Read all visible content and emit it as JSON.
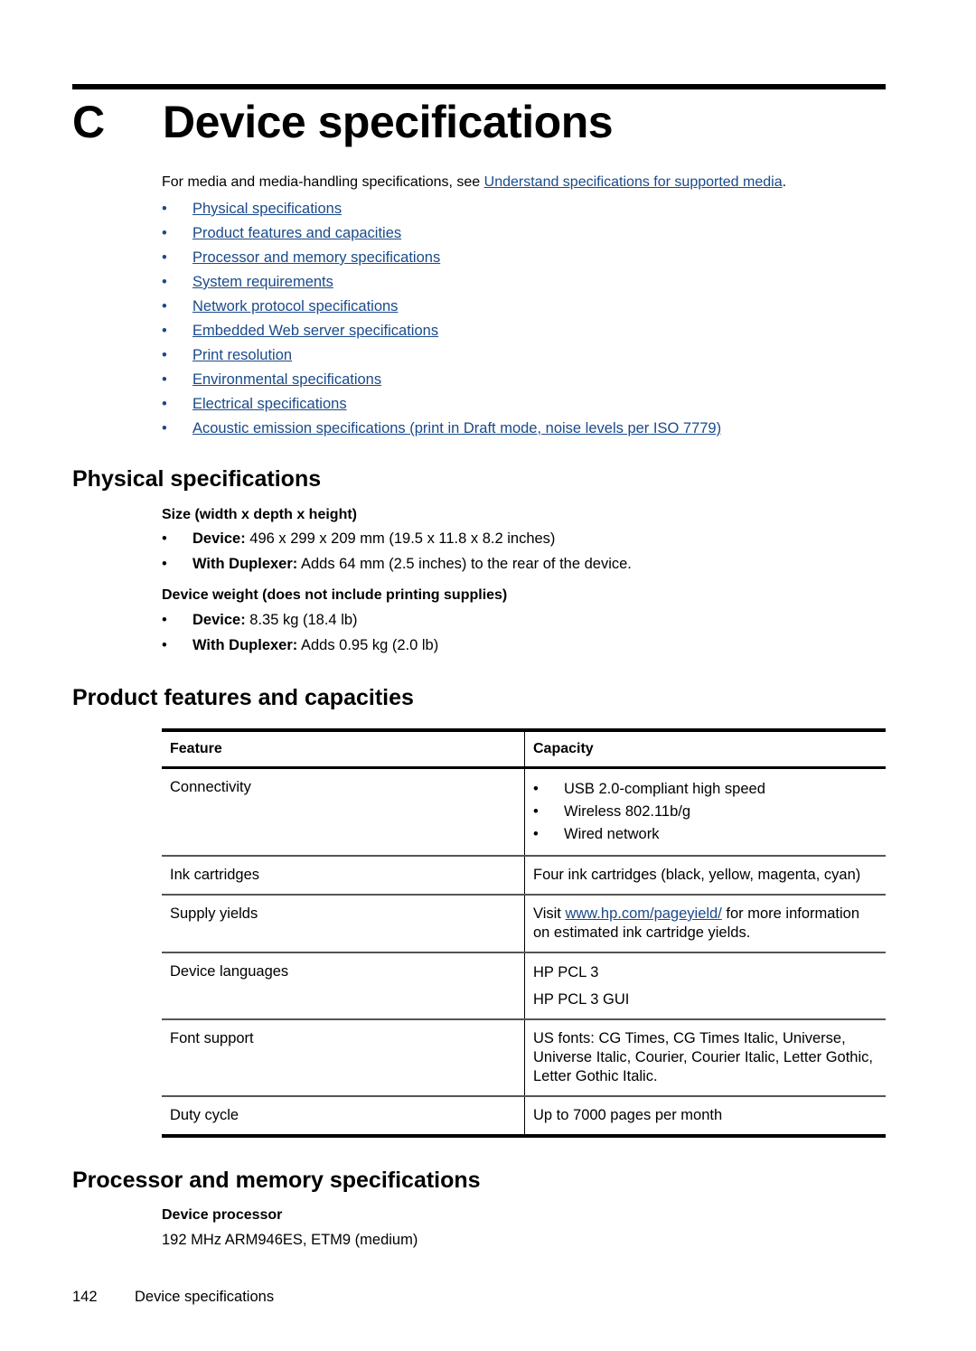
{
  "chapter": {
    "letter": "C",
    "title": "Device specifications"
  },
  "intro": {
    "text": "For media and media-handling specifications, see ",
    "link": "Understand specifications for supported media",
    "suffix": "."
  },
  "toc": [
    "Physical specifications",
    "Product features and capacities",
    "Processor and memory specifications",
    "System requirements",
    "Network protocol specifications",
    "Embedded Web server specifications",
    "Print resolution",
    "Environmental specifications",
    "Electrical specifications",
    "Acoustic emission specifications (print in Draft mode, noise levels per ISO 7779)"
  ],
  "physical": {
    "heading": "Physical specifications",
    "size_heading": "Size (width x depth x height)",
    "size_items": [
      {
        "label": "Device:",
        "value": " 496 x 299 x 209 mm (19.5 x 11.8 x 8.2 inches)"
      },
      {
        "label": "With Duplexer:",
        "value": " Adds 64 mm (2.5 inches) to the rear of the device."
      }
    ],
    "weight_heading": "Device weight (does not include printing supplies)",
    "weight_items": [
      {
        "label": "Device:",
        "value": " 8.35 kg (18.4 lb)"
      },
      {
        "label": "With Duplexer:",
        "value": " Adds 0.95 kg (2.0 lb)"
      }
    ]
  },
  "features": {
    "heading": "Product features and capacities",
    "columns": [
      "Feature",
      "Capacity"
    ],
    "rows": [
      {
        "feature": "Connectivity",
        "capacity_bullets": [
          "USB 2.0-compliant high speed",
          "Wireless 802.11b/g",
          "Wired network"
        ]
      },
      {
        "feature": "Ink cartridges",
        "capacity": "Four ink cartridges (black, yellow, magenta, cyan)"
      },
      {
        "feature": "Supply yields",
        "capacity_prefix": "Visit ",
        "capacity_link": "www.hp.com/pageyield/",
        "capacity_suffix": " for more information on estimated ink cartridge yields."
      },
      {
        "feature": "Device languages",
        "capacity_lines": [
          "HP PCL 3",
          "HP PCL 3 GUI"
        ]
      },
      {
        "feature": "Font support",
        "capacity": "US fonts: CG Times, CG Times Italic, Universe, Universe Italic, Courier, Courier Italic, Letter Gothic, Letter Gothic Italic."
      },
      {
        "feature": "Duty cycle",
        "capacity": "Up to 7000 pages per month"
      }
    ]
  },
  "processor": {
    "heading": "Processor and memory specifications",
    "sub_heading": "Device processor",
    "value": "192 MHz ARM946ES, ETM9 (medium)"
  },
  "footer": {
    "page_number": "142",
    "section": "Device specifications"
  },
  "colors": {
    "link": "#1a4a8a",
    "text": "#000000"
  }
}
